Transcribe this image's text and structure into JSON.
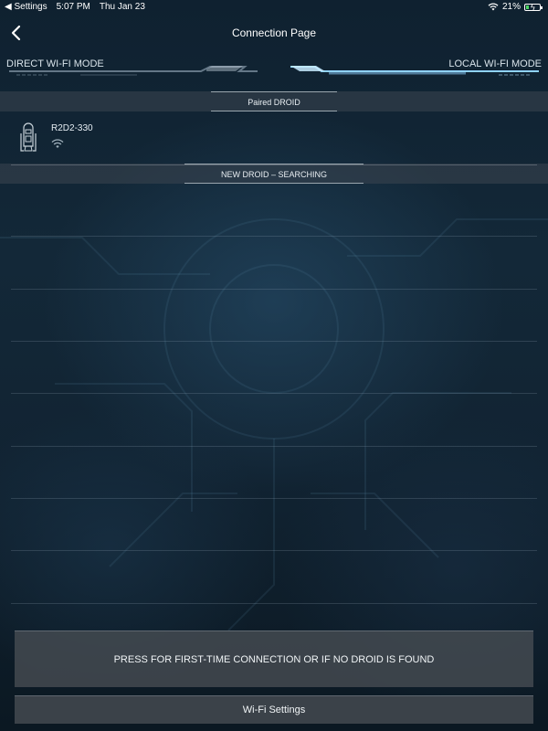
{
  "status_bar": {
    "back_app": "◀ Settings",
    "time": "5:07 PM",
    "date": "Thu Jan 23",
    "battery": "21%"
  },
  "nav": {
    "title": "Connection Page"
  },
  "modes": {
    "left": "DIRECT WI-FI MODE",
    "right": "LOCAL WI-FI MODE"
  },
  "sections": {
    "paired": "Paired DROID",
    "new": "NEW DROID – SEARCHING"
  },
  "paired_droids": [
    {
      "name": "R2D2-330"
    }
  ],
  "buttons": {
    "first_time": "PRESS FOR FIRST-TIME CONNECTION OR IF NO DROID IS FOUND",
    "wifi_settings": "Wi-Fi Settings"
  },
  "colors": {
    "accent": "#7fb7d4",
    "battery_charging": "#4cd964"
  }
}
